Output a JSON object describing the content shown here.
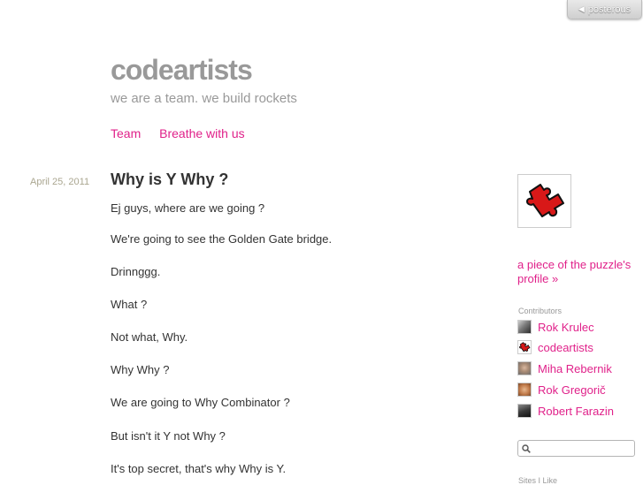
{
  "topbar": {
    "posterous_label": "posterous",
    "arrow_icon": "left-arrow-icon"
  },
  "blog": {
    "title": "codeartists",
    "tagline": "we are a team. we build rockets",
    "nav": [
      "Team",
      "Breathe with us"
    ]
  },
  "post": {
    "date": "April 25, 2011",
    "title": "Why is Y Why ?",
    "paragraphs": [
      "Ej guys, where are we going ?",
      "We're going to see the Golden Gate bridge.",
      "Drinnggg.",
      "What ?",
      "Not what, Why.",
      "Why Why ?",
      "We are going to Why Combinator ?",
      "But isn't it Y not Why ?",
      "It's top secret, that's why Why is Y."
    ]
  },
  "sidebar": {
    "profile_link": "a piece of the puzzle's profile »",
    "contributors_heading": "Contributors",
    "contributors": [
      {
        "name": "Rok Krulec"
      },
      {
        "name": "codeartists"
      },
      {
        "name": "Miha Rebernik"
      },
      {
        "name": "Rok Gregorič"
      },
      {
        "name": "Robert Farazin"
      }
    ],
    "search_placeholder": "",
    "sites_heading": "Sites I Like"
  },
  "colors": {
    "accent": "#e0218a",
    "title_gray": "#999999",
    "date_color": "#aaa690"
  }
}
